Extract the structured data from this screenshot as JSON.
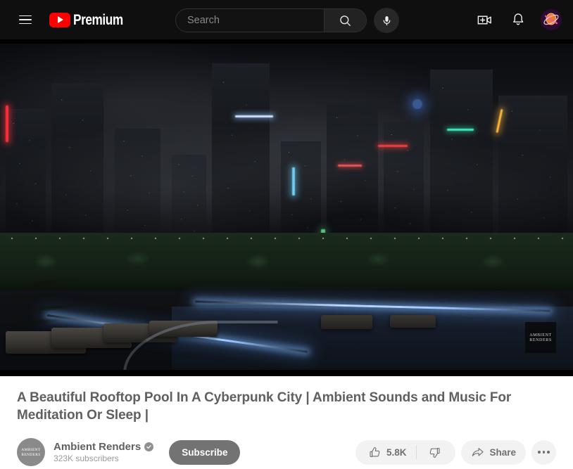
{
  "masthead": {
    "menu_icon": "hamburger-menu-icon",
    "logo_text": "Premium",
    "logo_icon": "youtube-play-icon",
    "search": {
      "placeholder": "Search",
      "value": "",
      "search_icon": "search-icon"
    },
    "mic_icon": "microphone-icon",
    "create_icon": "create-video-icon",
    "notifications_icon": "bell-icon",
    "avatar": "user-avatar",
    "background_color": "#0f0f0f"
  },
  "player": {
    "watermark_line1": "AMBIENT",
    "watermark_line2": "RENDERS",
    "background_color": "#000000"
  },
  "video": {
    "title": "A Beautiful Rooftop Pool In A Cyberpunk City | Ambient Sounds and Music For Meditation Or Sleep |",
    "channel": {
      "name": "Ambient Renders",
      "subscribers": "323K subscribers",
      "verified_icon": "verified-check-icon",
      "avatar_line1": "AMBIENT",
      "avatar_line2": "RENDERS"
    },
    "subscribe_label": "Subscribe",
    "actions": {
      "like_count": "5.8K",
      "like_icon": "thumbs-up-icon",
      "dislike_icon": "thumbs-down-icon",
      "share_label": "Share",
      "share_icon": "share-arrow-icon",
      "more_icon": "more-horizontal-icon"
    }
  },
  "colors": {
    "brand_red": "#ff0000",
    "page_background": "#ffffff",
    "text_gray": "#606060",
    "pill_background": "#f2f2f2",
    "subscribe_background": "#737373"
  }
}
